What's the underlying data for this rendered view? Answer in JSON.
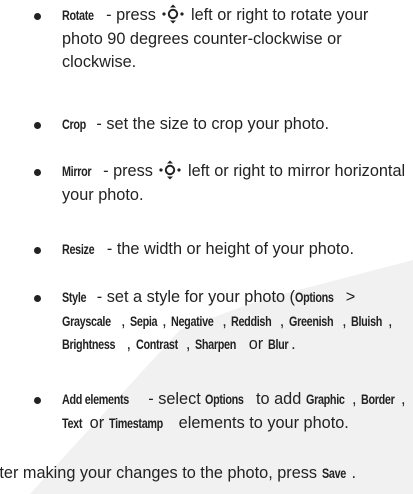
{
  "bullets": [
    {
      "name": "rotate",
      "term": "Rotate",
      "before_icon": " - press",
      "icon": "navigation-key-icon",
      "after_icon": "left or right to rotate your photo 90 degrees counter-clockwise or clockwise."
    },
    {
      "name": "crop",
      "term": "Crop",
      "text": " - set the size to crop your photo."
    },
    {
      "name": "mirror",
      "term": "Mirror",
      "before_icon": " - press",
      "icon": "navigation-key-icon",
      "after_icon": "left or right to mirror horizontal your photo."
    },
    {
      "name": "resize",
      "term": "Resize",
      "text": " - the width or height of your photo."
    },
    {
      "name": "style",
      "term": "Style",
      "text1": " - set a style for your photo (",
      "options": "Options",
      "gt": " > ",
      "items": [
        "Grayscale",
        "Sepia",
        "Negative",
        "Reddish",
        "Greenish",
        "Bluish",
        "Brightness",
        "Contrast",
        "Sharpen"
      ],
      "sep": ", ",
      "or": " or ",
      "last": "Blur",
      "end": "."
    },
    {
      "name": "add-elements",
      "term": "Add elements",
      "t1": " - select ",
      "options": "Options",
      "t2": " to add ",
      "e1": "Graphic",
      "e2": "Border",
      "e3": "Text",
      "or": " or ",
      "e4": "Timestamp",
      "t3": " elements to your photo.",
      "sep": ", "
    }
  ],
  "footer": {
    "text": "After making your changes to the photo, press ",
    "key": "Save",
    "end": "."
  }
}
